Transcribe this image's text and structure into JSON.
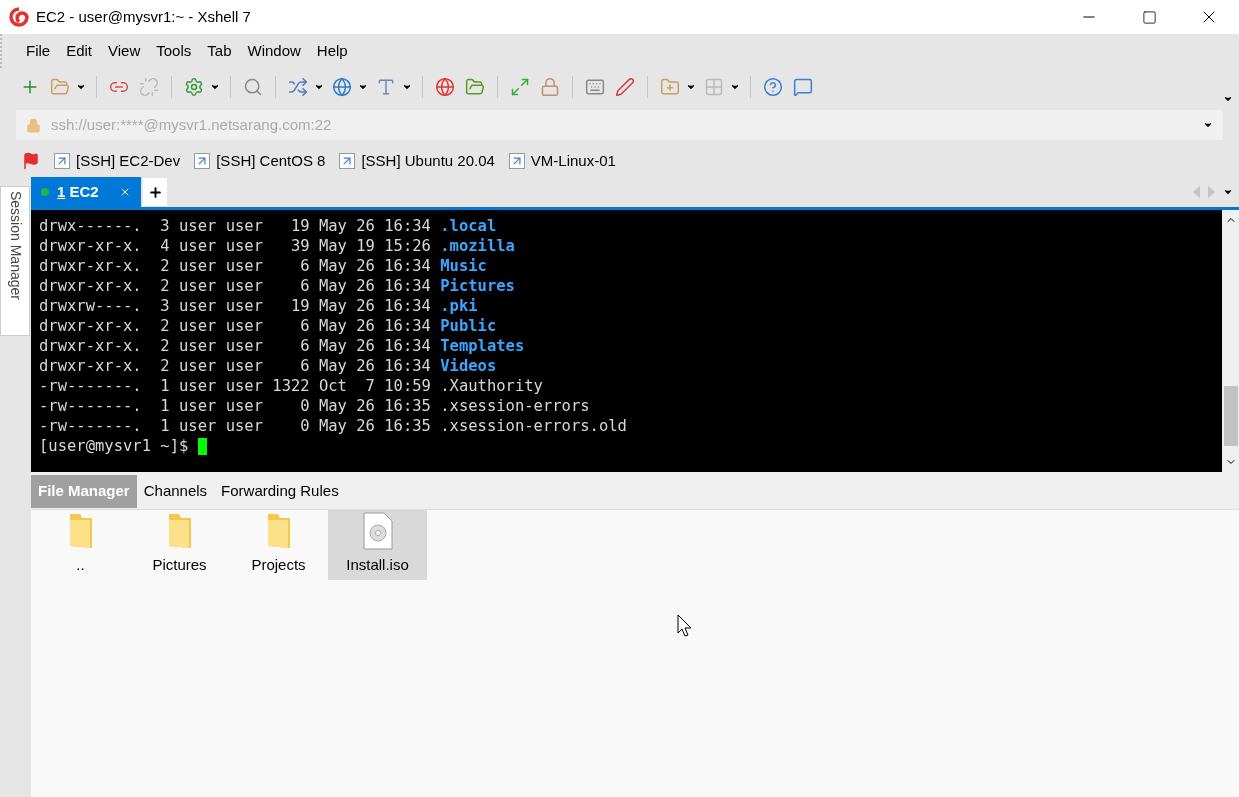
{
  "window": {
    "title": "EC2 - user@mysvr1:~ - Xshell 7"
  },
  "menu": [
    "File",
    "Edit",
    "View",
    "Tools",
    "Tab",
    "Window",
    "Help"
  ],
  "address_bar": {
    "value": "ssh://user:****@mysvr1.netsarang.com:22"
  },
  "quick_links": [
    "[SSH] EC2-Dev",
    "[SSH] CentOS 8",
    "[SSH] Ubuntu 20.04",
    "VM-Linux-01"
  ],
  "session_tabs": [
    {
      "number": "1",
      "label": "EC2",
      "selected": true,
      "connected": true
    }
  ],
  "side_panel": {
    "label": "Session Manager"
  },
  "terminal": {
    "lines": [
      {
        "info": "drwx------.  3 user user   19 May 26 16:34 ",
        "name": ".local",
        "kind": "dir"
      },
      {
        "info": "drwxr-xr-x.  4 user user   39 May 19 15:26 ",
        "name": ".mozilla",
        "kind": "dir"
      },
      {
        "info": "drwxr-xr-x.  2 user user    6 May 26 16:34 ",
        "name": "Music",
        "kind": "dir"
      },
      {
        "info": "drwxr-xr-x.  2 user user    6 May 26 16:34 ",
        "name": "Pictures",
        "kind": "dir"
      },
      {
        "info": "drwxrw----.  3 user user   19 May 26 16:34 ",
        "name": ".pki",
        "kind": "dir"
      },
      {
        "info": "drwxr-xr-x.  2 user user    6 May 26 16:34 ",
        "name": "Public",
        "kind": "dir"
      },
      {
        "info": "drwxr-xr-x.  2 user user    6 May 26 16:34 ",
        "name": "Templates",
        "kind": "dir"
      },
      {
        "info": "drwxr-xr-x.  2 user user    6 May 26 16:34 ",
        "name": "Videos",
        "kind": "dir"
      },
      {
        "info": "-rw-------.  1 user user 1322 Oct  7 10:59 ",
        "name": ".Xauthority",
        "kind": "file"
      },
      {
        "info": "-rw-------.  1 user user    0 May 26 16:35 ",
        "name": ".xsession-errors",
        "kind": "file"
      },
      {
        "info": "-rw-------.  1 user user    0 May 26 16:35 ",
        "name": ".xsession-errors.old",
        "kind": "file"
      }
    ],
    "prompt": "[user@mysvr1 ~]$ "
  },
  "bottom_tabs": [
    {
      "label": "File Manager",
      "selected": true
    },
    {
      "label": "Channels",
      "selected": false
    },
    {
      "label": "Forwarding Rules",
      "selected": false
    }
  ],
  "files": [
    {
      "name": "..",
      "kind": "folder",
      "selected": false
    },
    {
      "name": "Pictures",
      "kind": "folder",
      "selected": false
    },
    {
      "name": "Projects",
      "kind": "folder",
      "selected": false
    },
    {
      "name": "Install.iso",
      "kind": "disc",
      "selected": true
    }
  ]
}
